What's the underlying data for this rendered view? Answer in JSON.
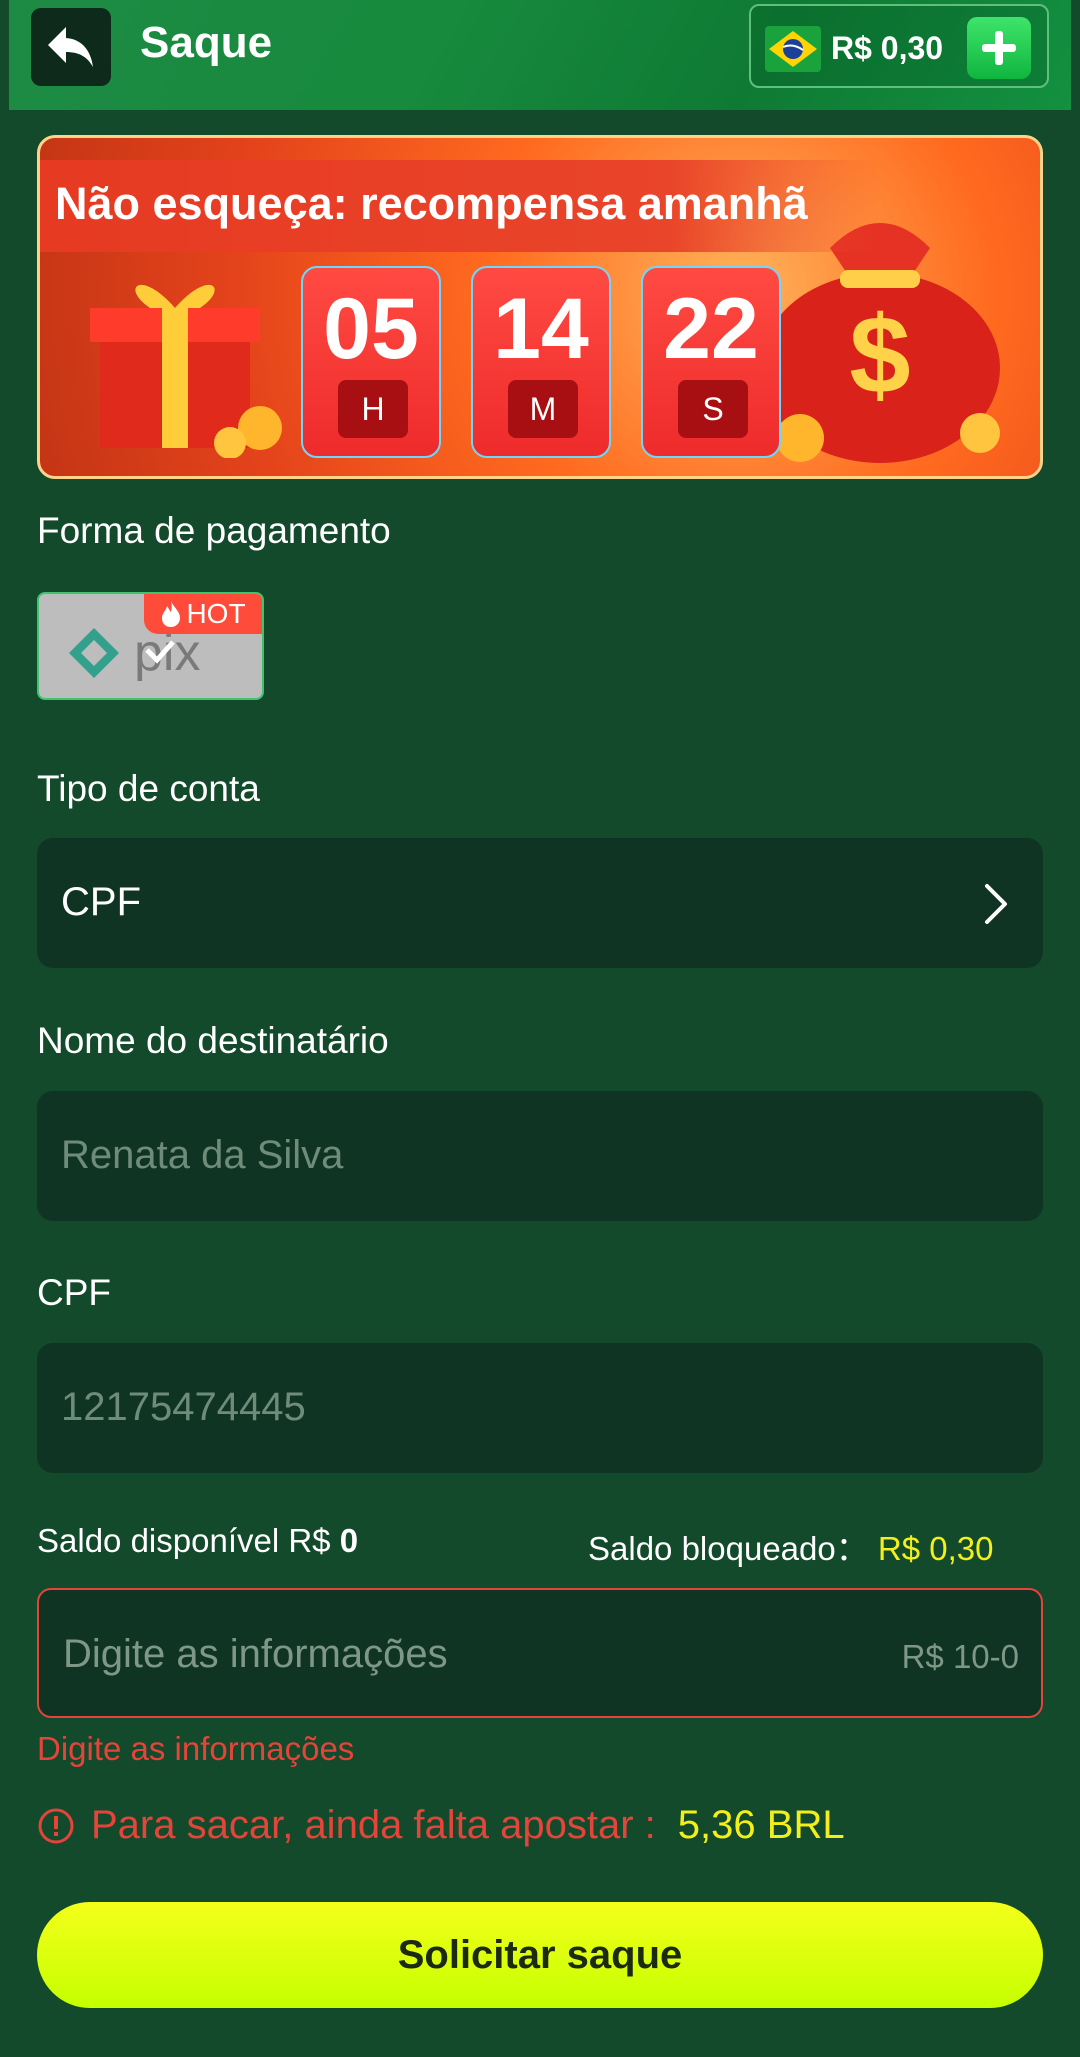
{
  "header": {
    "title": "Saque",
    "balance": "R$ 0,30"
  },
  "banner": {
    "title": "Não esqueça: recompensa amanhã",
    "timer": [
      {
        "value": "05",
        "unit": "H"
      },
      {
        "value": "14",
        "unit": "M"
      },
      {
        "value": "22",
        "unit": "S"
      }
    ]
  },
  "payment": {
    "label": "Forma de pagamento",
    "method_badge": "HOT"
  },
  "account_type": {
    "label": "Tipo de conta",
    "value": "CPF"
  },
  "recipient": {
    "label": "Nome do destinatário",
    "placeholder": "Renata  da Silva"
  },
  "cpf": {
    "label": "CPF",
    "placeholder": "12175474445"
  },
  "balances": {
    "available_label": "Saldo disponível R$",
    "available_value": "0",
    "blocked_label": "Saldo bloqueado：",
    "blocked_value": "R$ 0,30"
  },
  "amount": {
    "placeholder": "Digite as informações",
    "range": "R$ 10-0",
    "error": "Digite as informações"
  },
  "warning": {
    "text": "Para sacar, ainda falta apostar :",
    "value": "5,36 BRL"
  },
  "submit_label": "Solicitar saque",
  "colors": {
    "background": "#124a2b",
    "accent_green": "#1e8b45",
    "error_red": "#e5443a",
    "highlight_yellow": "#f3ef1c",
    "button_yellow": "#d9ff00"
  }
}
